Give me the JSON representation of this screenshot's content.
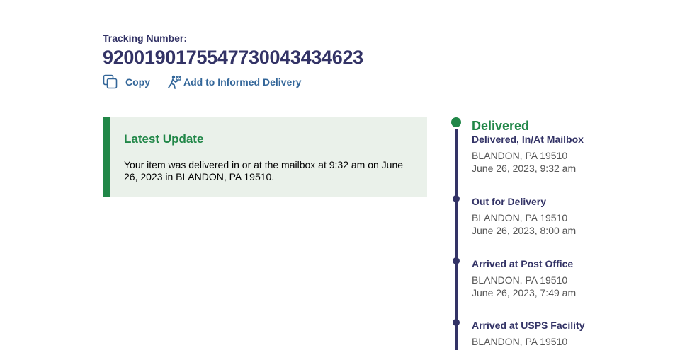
{
  "tracking": {
    "label": "Tracking Number:",
    "number": "9200190175547730043434623"
  },
  "actions": {
    "copy_label": "Copy",
    "informed_label": "Add to Informed Delivery"
  },
  "latest_update": {
    "title": "Latest Update",
    "text": "Your item was delivered in or at the mailbox at 9:32 am on June 26, 2023 in BLANDON, PA 19510."
  },
  "timeline": {
    "current": {
      "headline": "Delivered",
      "status": "Delivered, In/At Mailbox",
      "location": "BLANDON, PA 19510",
      "date": "June 26, 2023, 9:32 am"
    },
    "events": [
      {
        "status": "Out for Delivery",
        "location": "BLANDON, PA 19510",
        "date": "June 26, 2023, 8:00 am"
      },
      {
        "status": "Arrived at Post Office",
        "location": "BLANDON, PA 19510",
        "date": "June 26, 2023, 7:49 am"
      },
      {
        "status": "Arrived at USPS Facility",
        "location": "BLANDON, PA 19510",
        "date": ""
      }
    ]
  },
  "colors": {
    "navy": "#333366",
    "green": "#218748",
    "link_blue": "#336699",
    "update_bg": "#eaf1ea"
  },
  "icons": [
    "copy-icon",
    "informed-delivery-icon"
  ]
}
